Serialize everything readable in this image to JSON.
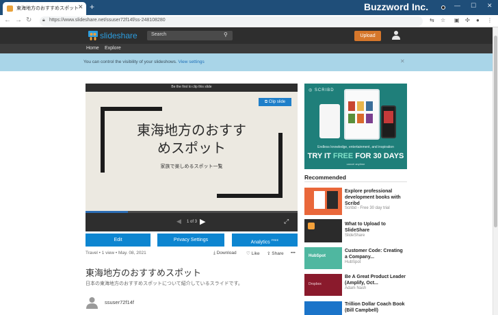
{
  "browser": {
    "tab_title": "東海地方のおすすめスポット",
    "new_tab": "+",
    "url": "https://www.slideshare.net/ssuser72f14f/ss-248108280",
    "brand_overlay": "Buzzword Inc."
  },
  "header": {
    "logo_text": "slideshare",
    "search_placeholder": "Search",
    "upload_label": "Upload",
    "nav": [
      "Home",
      "Explore"
    ]
  },
  "notice": {
    "text": "You can control the visibility of your slideshows.",
    "link": "View settings"
  },
  "player": {
    "first_clip": "Be the first to clip this slide",
    "clip_button": "Clip slide",
    "slide_title_line1": "東海地方のおすす",
    "slide_title_line2": "めスポット",
    "slide_subtitle": "家族で楽しめるスポット一覧",
    "pager": "1 of 3",
    "progress": 0.2
  },
  "actions": {
    "edit": "Edit",
    "privacy": "Privacy Settings",
    "analytics": "Analytics",
    "analytics_badge": "FREE"
  },
  "meta": {
    "text": "Travel • 1 view • May. 08, 2021",
    "download": "Download",
    "like": "Like",
    "share": "Share",
    "more": "•••"
  },
  "presentation": {
    "title": "東海地方のおすすめスポット",
    "description": "日本の東海地方のおすすめスポットについて紹介しているスライドです。",
    "author": "ssuser72f14f"
  },
  "ad": {
    "brand": "SCRIBD",
    "tagline": "Endless knowledge, entertainment, and inspiration",
    "cta_pre": "TRY IT ",
    "cta_free": "FREE",
    "cta_post": " FOR 30 DAYS",
    "note": "cancel anytime"
  },
  "recommended": {
    "heading": "Recommended",
    "items": [
      {
        "title": "Explore professional development books with Scribd",
        "source": "Scribd - Free 30 day trial",
        "color": "#e9673a"
      },
      {
        "title": "What to Upload to SlideShare",
        "source": "SlideShare",
        "color": "#2b2b2b"
      },
      {
        "title": "Customer Code: Creating a Company...",
        "source": "HubSpot",
        "color": "#4fb7a0"
      },
      {
        "title": "Be A Great Product Leader (Amplify, Oct...",
        "source": "Adam Nash",
        "color": "#8a1a2c"
      },
      {
        "title": "Trillion Dollar Coach Book (Bill Campbell)",
        "source": "",
        "color": "#1b74c9"
      }
    ]
  }
}
